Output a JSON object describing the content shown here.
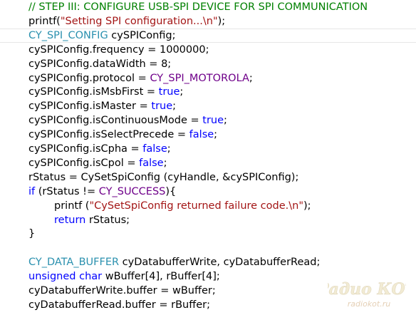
{
  "editor": {
    "lines": [
      {
        "indent": 1,
        "tokens": [
          {
            "t": "// STEP III: CONFIGURE USB-SPI DEVICE FOR SPI COMMUNICATION",
            "c": "comment"
          }
        ]
      },
      {
        "indent": 1,
        "tokens": [
          {
            "t": "printf(",
            "c": "plain"
          },
          {
            "t": "\"Setting SPI configuration...\\n\"",
            "c": "string"
          },
          {
            "t": ");",
            "c": "plain"
          }
        ]
      },
      {
        "indent": 1,
        "highlight": true,
        "tokens": [
          {
            "t": "CY_SPI_CONFIG",
            "c": "type"
          },
          {
            "t": " cySPIConfig;",
            "c": "plain"
          }
        ]
      },
      {
        "indent": 1,
        "tokens": [
          {
            "t": "cySPIConfig.frequency = 1000000;",
            "c": "plain"
          }
        ]
      },
      {
        "indent": 1,
        "tokens": [
          {
            "t": "cySPIConfig.dataWidth = 8;",
            "c": "plain"
          }
        ]
      },
      {
        "indent": 1,
        "tokens": [
          {
            "t": "cySPIConfig.protocol = ",
            "c": "plain"
          },
          {
            "t": "CY_SPI_MOTOROLA",
            "c": "macro"
          },
          {
            "t": ";",
            "c": "plain"
          }
        ]
      },
      {
        "indent": 1,
        "tokens": [
          {
            "t": "cySPIConfig.isMsbFirst = ",
            "c": "plain"
          },
          {
            "t": "true",
            "c": "keyword"
          },
          {
            "t": ";",
            "c": "plain"
          }
        ]
      },
      {
        "indent": 1,
        "tokens": [
          {
            "t": "cySPIConfig.isMaster = ",
            "c": "plain"
          },
          {
            "t": "true",
            "c": "keyword"
          },
          {
            "t": ";",
            "c": "plain"
          }
        ]
      },
      {
        "indent": 1,
        "tokens": [
          {
            "t": "cySPIConfig.isContinuousMode = ",
            "c": "plain"
          },
          {
            "t": "true",
            "c": "keyword"
          },
          {
            "t": ";",
            "c": "plain"
          }
        ]
      },
      {
        "indent": 1,
        "tokens": [
          {
            "t": "cySPIConfig.isSelectPrecede = ",
            "c": "plain"
          },
          {
            "t": "false",
            "c": "keyword"
          },
          {
            "t": ";",
            "c": "plain"
          }
        ]
      },
      {
        "indent": 1,
        "tokens": [
          {
            "t": "cySPIConfig.isCpha = ",
            "c": "plain"
          },
          {
            "t": "false",
            "c": "keyword"
          },
          {
            "t": ";",
            "c": "plain"
          }
        ]
      },
      {
        "indent": 1,
        "tokens": [
          {
            "t": "cySPIConfig.isCpol = ",
            "c": "plain"
          },
          {
            "t": "false",
            "c": "keyword"
          },
          {
            "t": ";",
            "c": "plain"
          }
        ]
      },
      {
        "indent": 1,
        "tokens": [
          {
            "t": "rStatus = CySetSpiConfig (cyHandle, &cySPIConfig);",
            "c": "plain"
          }
        ]
      },
      {
        "indent": 1,
        "tokens": [
          {
            "t": "if",
            "c": "keyword"
          },
          {
            "t": " (rStatus != ",
            "c": "plain"
          },
          {
            "t": "CY_SUCCESS",
            "c": "macro"
          },
          {
            "t": "){",
            "c": "plain"
          }
        ]
      },
      {
        "indent": 2,
        "tokens": [
          {
            "t": "printf (",
            "c": "plain"
          },
          {
            "t": "\"CySetSpiConfig returned failure code.\\n\"",
            "c": "string"
          },
          {
            "t": ");",
            "c": "plain"
          }
        ]
      },
      {
        "indent": 2,
        "tokens": [
          {
            "t": "return",
            "c": "keyword"
          },
          {
            "t": " rStatus;",
            "c": "plain"
          }
        ]
      },
      {
        "indent": 1,
        "tokens": [
          {
            "t": "}",
            "c": "plain"
          }
        ]
      },
      {
        "indent": 1,
        "tokens": []
      },
      {
        "indent": 1,
        "tokens": [
          {
            "t": "CY_DATA_BUFFER",
            "c": "type"
          },
          {
            "t": " cyDatabufferWrite, cyDatabufferRead;",
            "c": "plain"
          }
        ]
      },
      {
        "indent": 1,
        "tokens": [
          {
            "t": "unsigned",
            "c": "keyword"
          },
          {
            "t": " ",
            "c": "plain"
          },
          {
            "t": "char",
            "c": "keyword"
          },
          {
            "t": " wBuffer[4], rBuffer[4];",
            "c": "plain"
          }
        ]
      },
      {
        "indent": 1,
        "tokens": [
          {
            "t": "cyDatabufferWrite.buffer = wBuffer;",
            "c": "plain"
          }
        ]
      },
      {
        "indent": 1,
        "tokens": [
          {
            "t": "cyDatabufferRead.buffer = rBuffer;",
            "c": "plain"
          }
        ]
      }
    ]
  },
  "colors": {
    "comment": "#008000",
    "string": "#a31515",
    "keyword": "#0000ff",
    "type": "#2b91af",
    "macro": "#6f008a",
    "plain": "#000000"
  },
  "watermark": {
    "logo_text": "Радио КОТ",
    "site_text": "radiokot.ru"
  }
}
